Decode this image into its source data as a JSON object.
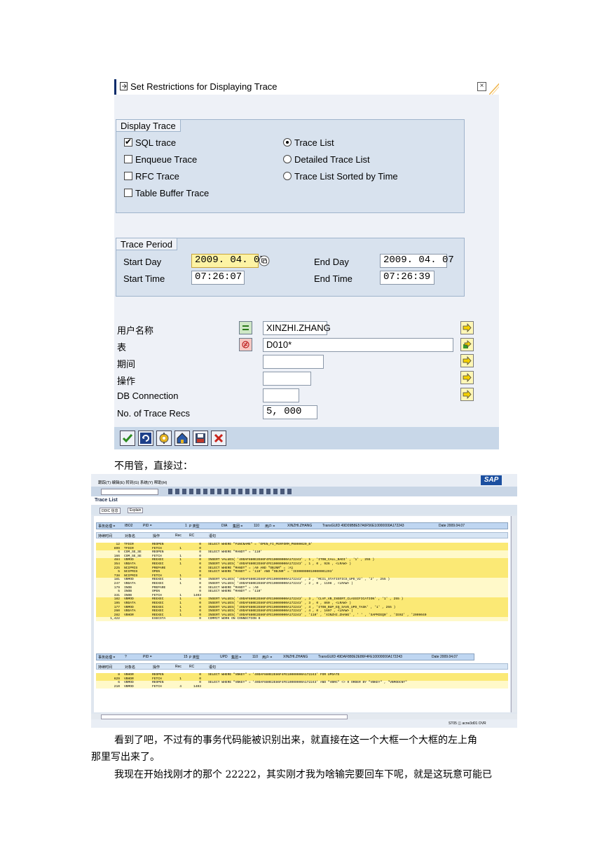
{
  "dialog": {
    "title": "Set Restrictions for Displaying Trace",
    "display_trace": {
      "label": "Display Trace",
      "checkboxes": [
        {
          "label": "SQL trace",
          "checked": true
        },
        {
          "label": "Enqueue Trace",
          "checked": false
        },
        {
          "label": "RFC Trace",
          "checked": false
        },
        {
          "label": "Table Buffer Trace",
          "checked": false
        }
      ],
      "radios": [
        {
          "label": "Trace List",
          "selected": true
        },
        {
          "label": "Detailed Trace List",
          "selected": false
        },
        {
          "label": "Trace List Sorted by Time",
          "selected": false
        }
      ]
    },
    "trace_period": {
      "label": "Trace Period",
      "start_day_label": "Start Day",
      "start_day": "2009. 04. 07",
      "start_time_label": "Start Time",
      "start_time": "07:26:07",
      "end_day_label": "End Day",
      "end_day": "2009. 04. 07",
      "end_time_label": "End Time",
      "end_time": "07:26:39"
    },
    "filters": {
      "user_label": "用户名称",
      "user_value": "XINZHI.ZHANG",
      "table_label": "表",
      "table_value": "D010*",
      "period_label": "期间",
      "period_value": "",
      "operation_label": "操作",
      "operation_value": "",
      "db_label": "DB Connection",
      "db_value": "",
      "recs_label": "No. of Trace Recs",
      "recs_value": "5, 000"
    }
  },
  "caption1": "不用管，直接过：",
  "trace_list": {
    "menu": "跟踪(T)  编辑(E)  转到(G)  系统(Y)  帮助(H)",
    "title": "Trace List",
    "toolbar_ddic": "DDIC 信息",
    "toolbar_explain": "Explain",
    "header1": {
      "trans": "事务处理 = ",
      "trans_val": "IBO2",
      "pid": "PID =",
      "pid_val": "1",
      "ptype": "P 类型",
      "ptype_val": "DIA",
      "client": "集团 =",
      "client_val": "110",
      "user": "用户 =",
      "user_val": "XINZHI.ZHANG",
      "guid": "TransGUID 49D09B8E57A6F56E10000000A172243",
      "date": "Date  2009.04.07"
    },
    "columns": [
      "持续时间",
      "对象名",
      "操作",
      "Rec",
      "RC",
      "语句"
    ],
    "rows1": [
      {
        "d": "12",
        "obj": "TFDIR",
        "op": "REOPEN",
        "rec": "",
        "rc": "0",
        "stmt": "SELECT WHERE \"FUNCNAME\" = 'OPEN_FI_PERFORM_PN000020_B'",
        "c": "y"
      },
      {
        "d": "899",
        "obj": "TFDIR",
        "op": "FETCH",
        "rec": "1",
        "rc": "0",
        "stmt": "",
        "c": "y"
      },
      {
        "d": "6",
        "obj": "COM_SE_SE",
        "op": "REOPEN",
        "rec": "",
        "rc": "0",
        "stmt": "SELECT WHERE \"MANDT\" = '110'",
        "c": "w"
      },
      {
        "d": "166",
        "obj": "COM_SE_SE",
        "op": "FETCH",
        "rec": "1",
        "rc": "0",
        "stmt": "",
        "c": "w"
      },
      {
        "d": "484",
        "obj": "VBMOD",
        "op": "REEXEC",
        "rec": "1",
        "rc": "0",
        "stmt": "INSERT VALUES( '49DAF880E2E86F4FE10000000A172243' , 1 , 'ITOB_CALL_BADI' , '1' , 255 )",
        "c": "y"
      },
      {
        "d": "354",
        "obj": "VBDATA",
        "op": "REEXEC",
        "rec": "1",
        "rc": "0",
        "stmt": "INSERT VALUES( '49DAF880E2E86F4FE10000000A172243' , 1 , 0 , 926 , <LRAW> )",
        "c": "y"
      },
      {
        "d": "225",
        "obj": "NCIPMIS",
        "op": "PREPARE",
        "rec": "",
        "rc": "0",
        "stmt": "SELECT WHERE \"MANDT\" = :A0 AND \"OBJNR\" = :A1",
        "c": "y"
      },
      {
        "d": "5",
        "obj": "NCIPMIS",
        "op": "OPEN",
        "rec": "",
        "rc": "0",
        "stmt": "SELECT WHERE \"MANDT\" = '110' AND \"OBJNR\" = 'IE000000010000001293'",
        "c": "y"
      },
      {
        "d": "738",
        "obj": "NCIPMIS",
        "op": "FETCH",
        "rec": "1",
        "rc": "0",
        "stmt": "",
        "c": "y"
      },
      {
        "d": "181",
        "obj": "VBMOD",
        "op": "REEXEC",
        "rec": "1",
        "rc": "0",
        "stmt": "INSERT VALUES( '49DAF880E2E86F4FE10000000A172243' , 2 , 'MCI1_STATISTICS_UPD_V2' , '2' , 255 )",
        "c": "w"
      },
      {
        "d": "247",
        "obj": "VBDATA",
        "op": "REEXEC",
        "rec": "1",
        "rc": "0",
        "stmt": "INSERT VALUES( '49DAF880E2E86F4FE10000000A172243' , 2 , 0 , 1198 , <LRAW> )",
        "c": "w"
      },
      {
        "d": "179",
        "obj": "INOB",
        "op": "PREPARE",
        "rec": "",
        "rc": "0",
        "stmt": "SELECT WHERE \"MANDT\" = :A0",
        "c": "w"
      },
      {
        "d": "5",
        "obj": "INOB",
        "op": "OPEN",
        "rec": "",
        "rc": "0",
        "stmt": "SELECT WHERE \"MANDT\" = '110'",
        "c": "w"
      },
      {
        "d": "331",
        "obj": "INOB",
        "op": "FETCH",
        "rec": "1",
        "rc": "1403",
        "stmt": "",
        "c": "w"
      },
      {
        "d": "182",
        "obj": "VBMOD",
        "op": "REEXEC",
        "rec": "1",
        "rc": "0",
        "stmt": "INSERT VALUES( '49DAF880E2E86F4FE10000000A172243' , 3 , 'CLVF_VB_INSERT_CLASSIFICATION' , '1' , 255 )",
        "c": "y"
      },
      {
        "d": "195",
        "obj": "VBDATA",
        "op": "REEXEC",
        "rec": "1",
        "rc": "0",
        "stmt": "INSERT VALUES( '49DAF880E2E86F4FE10000000A172243' , 3 , 0 , 860 , <LRAW> )",
        "c": "y"
      },
      {
        "d": "177",
        "obj": "VBMOD",
        "op": "REEXEC",
        "rec": "1",
        "rc": "0",
        "stmt": "INSERT VALUES( '49DAF880E2E86F4FE10000000A172243' , 4 , 'ITOB_BUP_EQ_SAVE_UPD_TASK' , '1' , 255 )",
        "c": "y"
      },
      {
        "d": "260",
        "obj": "VBDATA",
        "op": "REEXEC",
        "rec": "1",
        "rc": "0",
        "stmt": "INSERT VALUES( '49DAF880E2E86F4FE10000000A172243' , 4 , 0 , 1607 , <LRAW> )",
        "c": "y"
      },
      {
        "d": "282",
        "obj": "VBHDR",
        "op": "REEXEC",
        "rec": "1",
        "rc": "0",
        "stmt": "INSERT VALUES( '49DAF880E2E86F4FE10000000A172243' , '110' , 'XINZHI.ZHANG' , ' ' , 'SAPMIEQ0' , 'IE02' , '2009040",
        "c": "y"
      },
      {
        "d": "1,422",
        "obj": "",
        "op": "EXECSTA",
        "rec": "",
        "rc": "0",
        "stmt": "COMMIT WORK ON CONNECTION 0",
        "c": "w"
      }
    ],
    "header2": {
      "trans": "事务处理 = ",
      "trans_val": "?",
      "pid": "PID =",
      "pid_val": "15",
      "ptype": "P 类型",
      "ptype_val": "UPD",
      "client": "集团 =",
      "client_val": "110",
      "user": "用户 =",
      "user_val": "XINZHI.ZHANG",
      "guid": "TransGUID 49DAF880E2E86F4FE10000000A172243",
      "date": "Date  2009.04.07"
    },
    "rows2": [
      {
        "d": "8",
        "obj": "VBHDR",
        "op": "REOPEN",
        "rec": "",
        "rc": "0",
        "stmt": "SELECT WHERE \"VBKEY\" = '49DAF880E2E86F4FE10000000A172243'  FOR UPDATE",
        "c": "y"
      },
      {
        "d": "629",
        "obj": "VBHDR",
        "op": "FETCH",
        "rec": "1",
        "rc": "0",
        "stmt": "",
        "c": "y"
      },
      {
        "d": "6",
        "obj": "VBMOD",
        "op": "REOPEN",
        "rec": "",
        "rc": "0",
        "stmt": "SELECT WHERE \"VBKEY\" = '49DAF880E2E86F4FE10000000A172243' AND \"VBRC\" <> 0 ORDER BY \"VBKEY\" , \"VBMODCNT\"",
        "c": "w"
      },
      {
        "d": "210",
        "obj": "VBMOD",
        "op": "FETCH",
        "rec": "4",
        "rc": "1403",
        "stmt": "",
        "c": "w"
      }
    ],
    "status": "ST05  ◫  acne3d01  OVR"
  },
  "caption2_line1": "看到了吧，不过有的事务代码能被识别出来，就直接在这一个大框一个大框的左上角",
  "caption2_line2": "那里写出来了。",
  "caption3": "我现在开始找刚才的那个 22222，其实刚才我为啥输完要回车下呢，就是这玩意可能已"
}
